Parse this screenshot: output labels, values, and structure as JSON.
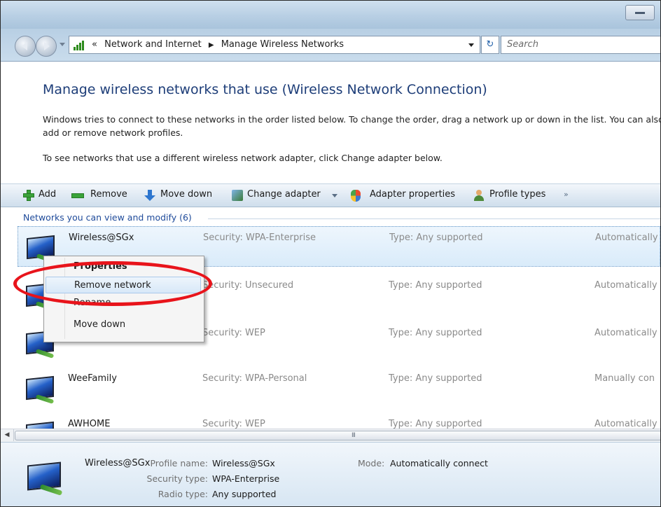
{
  "address_bar": {
    "crumb_prefix": "«",
    "crumb1": "Network and Internet",
    "separator": "▶",
    "crumb2": "Manage Wireless Networks",
    "refresh_glyph": "↻",
    "search_placeholder": "Search"
  },
  "header": {
    "title": "Manage wireless networks that use (Wireless Network Connection)",
    "description": "Windows tries to connect to these networks in the order listed below. To change the order, drag a network up or down in the list. You can also add or remove network profiles.",
    "adapter_hint": "To see networks that use a different wireless network adapter, click Change adapter below."
  },
  "toolbar": {
    "add": "Add",
    "remove": "Remove",
    "move_down": "Move down",
    "change_adapter": "Change adapter",
    "adapter_properties": "Adapter properties",
    "profile_types": "Profile types",
    "more": "»"
  },
  "list": {
    "group_header": "Networks you can view and modify (6)",
    "rows": [
      {
        "name": "Wireless@SGx",
        "security": "Security: WPA-Enterprise",
        "type": "Type: Any supported",
        "mode": "Automatically"
      },
      {
        "name": "",
        "security": "Security: Unsecured",
        "type": "Type: Any supported",
        "mode": "Automatically"
      },
      {
        "name": "",
        "security": "Security: WEP",
        "type": "Type: Any supported",
        "mode": "Automatically"
      },
      {
        "name": "WeeFamily",
        "security": "Security: WPA-Personal",
        "type": "Type: Any supported",
        "mode": "Manually con"
      },
      {
        "name": "AWHOME",
        "security": "Security: WEP",
        "type": "Type: Any supported",
        "mode": "Automatically"
      }
    ]
  },
  "context_menu": {
    "items": [
      "Properties",
      "Remove network",
      "Rename",
      "Move down"
    ]
  },
  "scrollbar": {
    "left_arrow": "◀",
    "grip": "III"
  },
  "details": {
    "name": "Wireless@SGx",
    "profile_label": "Profile name:",
    "profile_value": "Wireless@SGx",
    "security_label": "Security type:",
    "security_value": "WPA-Enterprise",
    "radio_label": "Radio type:",
    "radio_value": "Any supported",
    "mode_label": "Mode:",
    "mode_value": "Automatically connect"
  },
  "colors": {
    "accent_blue": "#1d3d78",
    "annotation_red": "#e8141b"
  }
}
